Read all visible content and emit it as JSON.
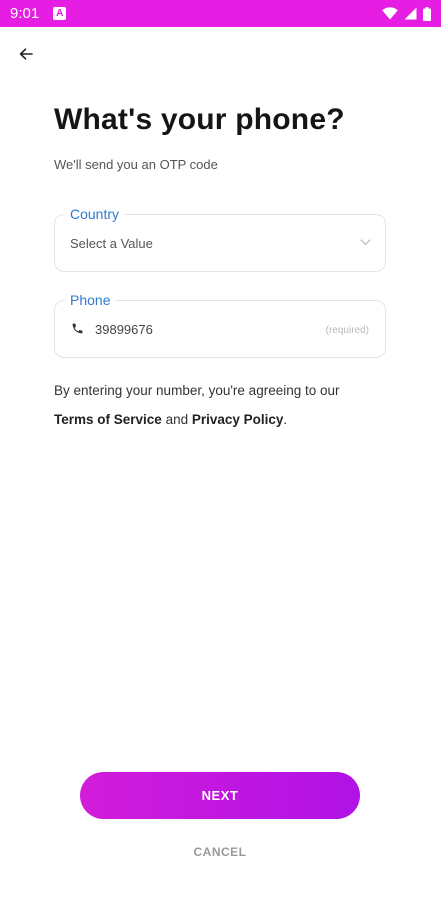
{
  "status_bar": {
    "time": "9:01",
    "notification_glyph": "A",
    "icons": [
      "wifi-icon",
      "signal-icon",
      "battery-icon"
    ],
    "background": "#e61ee3"
  },
  "header": {
    "back_icon": "arrow-left-icon"
  },
  "main": {
    "title": "What's your phone?",
    "subtitle": "We'll send you an OTP code",
    "country_field": {
      "label": "Country",
      "value": "Select a Value",
      "icon": "chevron-down-icon"
    },
    "phone_field": {
      "label": "Phone",
      "value": "39899676",
      "hint": "(required)",
      "icon": "phone-icon"
    },
    "agreement": {
      "line1": "By entering your number, you're agreeing to our",
      "terms_link": "Terms of Service",
      "conjunction": " and ",
      "privacy_link": "Privacy Policy",
      "end": "."
    }
  },
  "actions": {
    "next_label": "NEXT",
    "cancel_label": "CANCEL",
    "accent_color": "#c817de",
    "label_color": "#2f7bd1"
  }
}
